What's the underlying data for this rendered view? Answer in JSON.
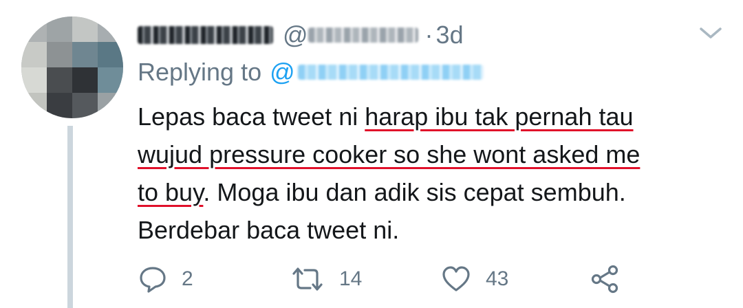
{
  "author": {
    "display_name": "",
    "handle_prefix": "@",
    "separator": "·",
    "timestamp": "3d"
  },
  "reply_context": {
    "label": "Replying to",
    "mention_prefix": "@"
  },
  "tweet": {
    "lines": [
      [
        "Lepas baca tweet ni ",
        "harap ibu tak pernah tau"
      ],
      [
        "wujud pressure cooker so she wont asked me"
      ],
      [
        "to buy",
        ". Moga ibu dan adik sis cepat sembuh."
      ],
      [
        "Berdebar baca tweet ni."
      ]
    ],
    "underline_color": "#e0102a"
  },
  "actions": {
    "reply_count": "2",
    "retweet_count": "14",
    "like_count": "43"
  },
  "icons": {
    "chevron": "chevron-down-icon",
    "reply": "reply-icon",
    "retweet": "retweet-icon",
    "like": "heart-icon",
    "share": "share-icon"
  },
  "colors": {
    "text": "#14171a",
    "secondary": "#657786",
    "link": "#1da1f2",
    "thread_line": "#ccd6dd"
  }
}
